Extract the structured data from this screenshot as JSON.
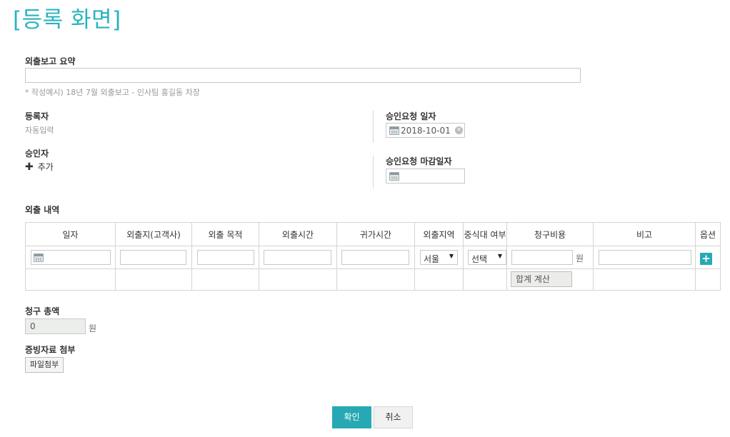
{
  "page": {
    "title": "[등록 화면]"
  },
  "summary": {
    "label": "외출보고 요약",
    "value": "",
    "hint": "* 작성예시) 18년 7월 외출보고 - 인사팀 홍길동 차장"
  },
  "registrant": {
    "label": "등록자",
    "value": "자동입력"
  },
  "approver": {
    "label": "승인자",
    "add_label": "추가"
  },
  "request_date": {
    "label": "승인요청 일자",
    "value": "2018-10-01"
  },
  "deadline_date": {
    "label": "승인요청 마감일자",
    "value": ""
  },
  "details": {
    "label": "외출 내역",
    "columns": [
      "일자",
      "외출지(고객사)",
      "외출 목적",
      "외출시간",
      "귀가시간",
      "외출지역",
      "중식대 여부",
      "청구비용",
      "비고",
      "옵션"
    ],
    "region_select": "서울",
    "lunch_select": "선택",
    "cost_unit": "원",
    "calc_label": "합계 계산"
  },
  "total": {
    "label": "청구 총액",
    "value": "0",
    "unit": "원"
  },
  "attachment": {
    "label": "증빙자료 첨부",
    "button_label": "파일첨부"
  },
  "actions": {
    "confirm": "확인",
    "cancel": "취소"
  },
  "colors": {
    "accent": "#26a9b4",
    "title": "#2ab3bf"
  }
}
